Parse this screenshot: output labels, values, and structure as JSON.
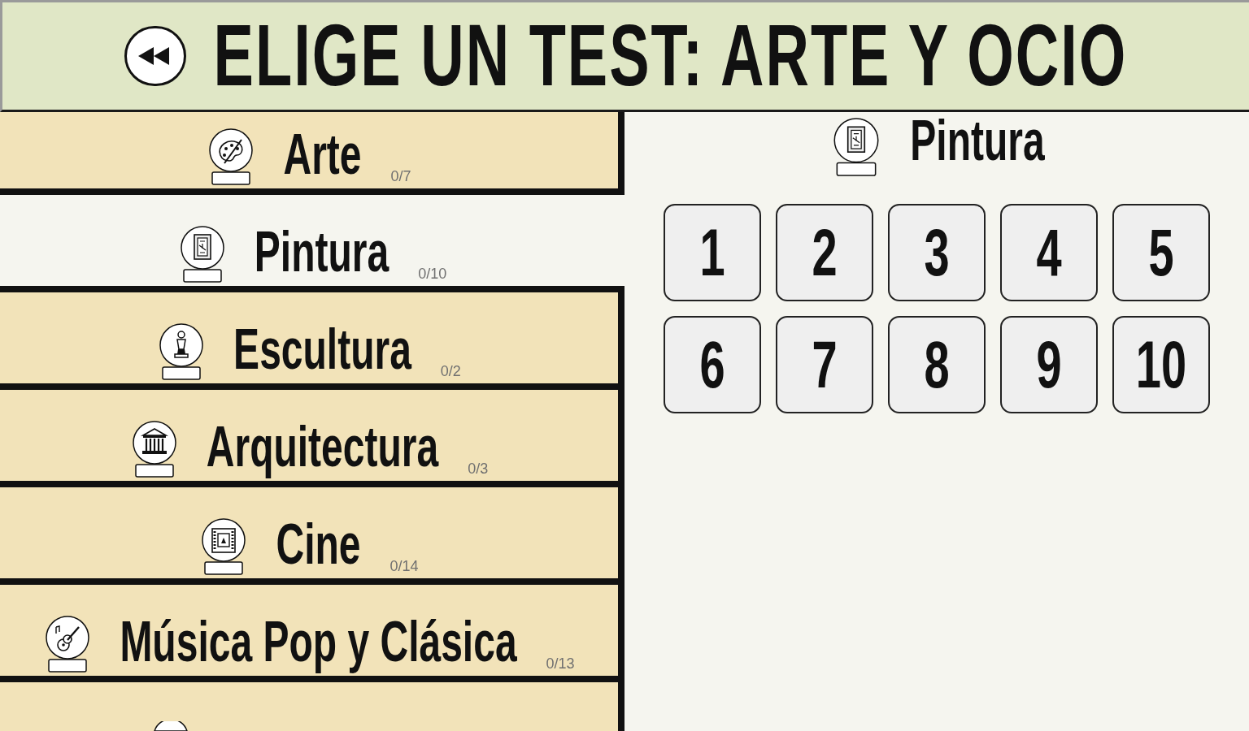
{
  "header": {
    "title": "ELIGE UN TEST: ARTE Y OCIO"
  },
  "categories": [
    {
      "kind": "palette",
      "label": "Arte",
      "progress": "0/7",
      "selected": false
    },
    {
      "kind": "frame",
      "label": "Pintura",
      "progress": "0/10",
      "selected": true
    },
    {
      "kind": "statue",
      "label": "Escultura",
      "progress": "0/2",
      "selected": false
    },
    {
      "kind": "columns",
      "label": "Arquitectura",
      "progress": "0/3",
      "selected": false
    },
    {
      "kind": "film",
      "label": "Cine",
      "progress": "0/14",
      "selected": false
    },
    {
      "kind": "guitar",
      "label": "Música Pop y Clásica",
      "progress": "0/13",
      "selected": false
    }
  ],
  "detail": {
    "kind": "frame",
    "title": "Pintura",
    "tests": [
      "1",
      "2",
      "3",
      "4",
      "5",
      "6",
      "7",
      "8",
      "9",
      "10"
    ]
  }
}
